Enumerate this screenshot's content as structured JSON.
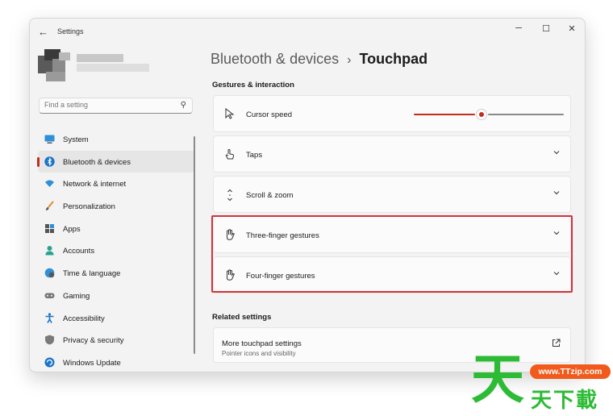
{
  "window": {
    "title": "Settings",
    "back_icon": "arrow-left-icon",
    "controls": [
      "─",
      "☐",
      "✕"
    ]
  },
  "search": {
    "placeholder": "Find a setting",
    "icon": "search-icon"
  },
  "nav": {
    "items": [
      {
        "label": "System",
        "icon": "monitor-icon",
        "active": false
      },
      {
        "label": "Bluetooth & devices",
        "icon": "bluetooth-icon",
        "active": true
      },
      {
        "label": "Network & internet",
        "icon": "wifi-icon",
        "active": false
      },
      {
        "label": "Personalization",
        "icon": "brush-icon",
        "active": false
      },
      {
        "label": "Apps",
        "icon": "apps-icon",
        "active": false
      },
      {
        "label": "Accounts",
        "icon": "person-icon",
        "active": false
      },
      {
        "label": "Time & language",
        "icon": "globe-clock-icon",
        "active": false
      },
      {
        "label": "Gaming",
        "icon": "gamepad-icon",
        "active": false
      },
      {
        "label": "Accessibility",
        "icon": "accessibility-icon",
        "active": false
      },
      {
        "label": "Privacy & security",
        "icon": "shield-icon",
        "active": false
      },
      {
        "label": "Windows Update",
        "icon": "update-icon",
        "active": false
      }
    ]
  },
  "breadcrumb": {
    "parent": "Bluetooth & devices",
    "separator": "›",
    "current": "Touchpad"
  },
  "gestures": {
    "section_title": "Gestures & interaction",
    "cursor_speed": {
      "label": "Cursor speed",
      "icon": "cursor-icon",
      "value_fraction": 0.45
    },
    "taps": {
      "label": "Taps",
      "icon": "tap-icon"
    },
    "scroll": {
      "label": "Scroll & zoom",
      "icon": "scroll-icon"
    },
    "three_finger": {
      "label": "Three-finger gestures",
      "icon": "hand-icon"
    },
    "four_finger": {
      "label": "Four-finger gestures",
      "icon": "hand-icon"
    }
  },
  "related": {
    "section_title": "Related settings",
    "more_touchpad": {
      "title": "More touchpad settings",
      "subtitle": "Pointer icons and visibility",
      "icon": "external-link-icon"
    }
  },
  "watermark": {
    "big": "天",
    "pill": "www.TTzip.com",
    "sub": "天下載"
  },
  "colors": {
    "accent": "#c42b1c",
    "highlight": "#d0343b",
    "watermark_green": "#2dbb35",
    "watermark_orange": "#f25a1c"
  }
}
